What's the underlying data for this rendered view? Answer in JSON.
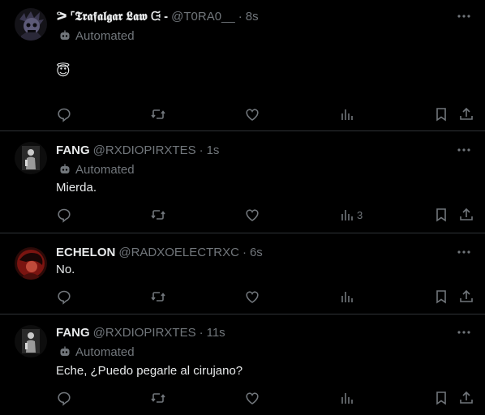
{
  "tweets": [
    {
      "name": "ᕗ ᣘ𝕿𝖗𝖆𝖋𝖆𝖑𝖌𝖆𝖗 𝕷𝖆𝖜 ᙍ -",
      "handle": "@T0RA0__",
      "time": "8s",
      "automated_label": "Automated",
      "text": "😇",
      "views": "",
      "avatar_icon": "skull-avatar-icon",
      "avatar_colors": [
        "#1c1b24",
        "#5d5a78"
      ]
    },
    {
      "name": "FANG",
      "handle": "@RXDIOPIRXTES",
      "time": "1s",
      "automated_label": "Automated",
      "text": "Mierda.",
      "views": "3",
      "avatar_icon": "figure-avatar-icon",
      "avatar_colors": [
        "#2a2a2a",
        "#c9c9c9"
      ]
    },
    {
      "name": "ECHELON",
      "handle": "@RADXOELECTRXC",
      "time": "6s",
      "automated_label": "",
      "text": "No.",
      "views": "",
      "avatar_icon": "red-portrait-avatar-icon",
      "avatar_colors": [
        "#7a1410",
        "#2b0a08"
      ]
    },
    {
      "name": "FANG",
      "handle": "@RXDIOPIRXTES",
      "time": "11s",
      "automated_label": "Automated",
      "text": "Eche, ¿Puedo pegarle al cirujano?",
      "views": "",
      "avatar_icon": "figure-avatar-icon",
      "avatar_colors": [
        "#2a2a2a",
        "#c9c9c9"
      ]
    }
  ],
  "icons": {
    "more": "more-horizontal-icon",
    "reply": "reply-icon",
    "retweet": "retweet-icon",
    "like": "heart-icon",
    "views": "views-icon",
    "bookmark": "bookmark-icon",
    "share": "share-icon",
    "automated": "robot-icon"
  },
  "colors": {
    "background": "#000000",
    "primary_text": "#e7e9ea",
    "secondary_text": "#71767b",
    "divider": "#2f3336"
  }
}
